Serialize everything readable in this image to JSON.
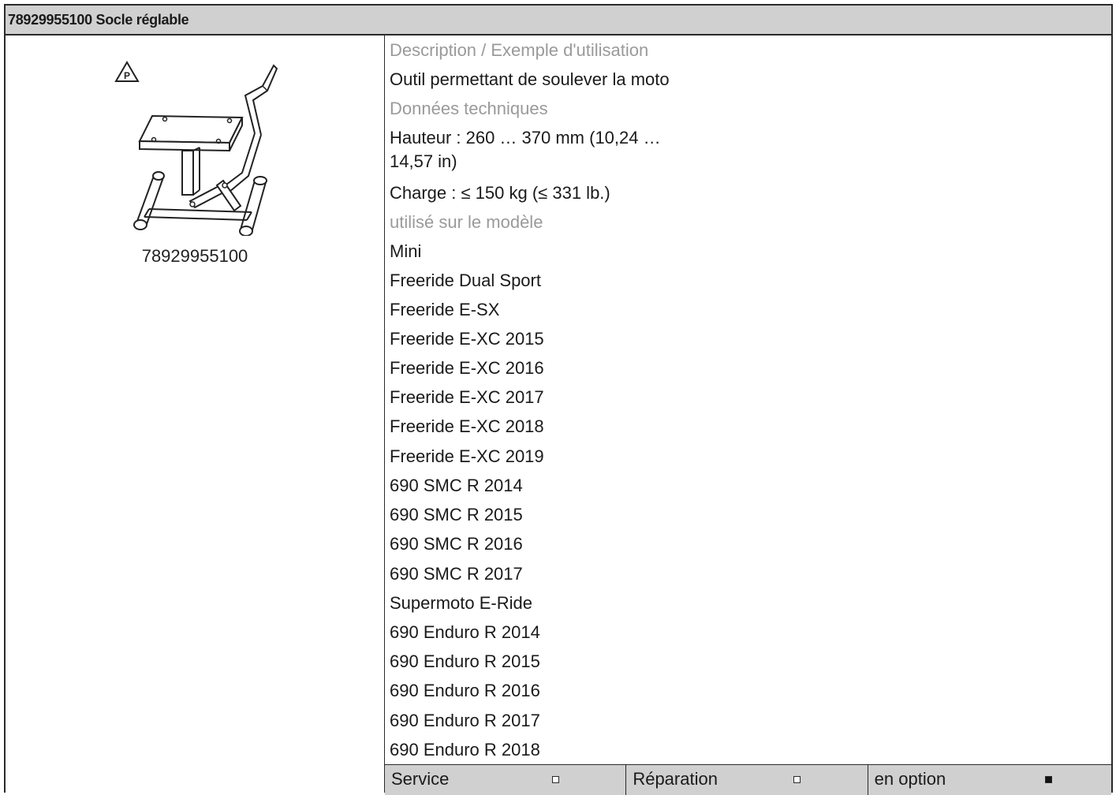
{
  "header": {
    "title": "78929955100 Socle réglable"
  },
  "figure": {
    "caption": "78929955100",
    "symbol_letter": "P",
    "icon": "lift-stand-icon"
  },
  "details": {
    "description_heading": "Description / Exemple d'utilisation",
    "description": "Outil permettant de soulever la moto",
    "technical_heading": "Données techniques",
    "height_line1": "Hauteur : 260 … 370 mm (10,24 …",
    "height_line2": "14,57 in)",
    "load": "Charge : ≤ 150 kg (≤ 331 lb.)",
    "models_heading": "utilisé sur le modèle",
    "models": [
      "Mini",
      "Freeride Dual Sport",
      "Freeride E-SX",
      "Freeride E-XC 2015",
      "Freeride E-XC 2016",
      "Freeride E-XC 2017",
      "Freeride E-XC 2018",
      "Freeride E-XC 2019",
      "690 SMC R 2014",
      "690 SMC R 2015",
      "690 SMC R 2016",
      "690 SMC R 2017",
      "Supermoto E-Ride",
      "690 Enduro R 2014",
      "690 Enduro R 2015",
      "690 Enduro R 2016",
      "690 Enduro R 2017",
      "690 Enduro R 2018"
    ]
  },
  "footer": {
    "service_label": "Service",
    "service_checked": false,
    "repair_label": "Réparation",
    "repair_checked": false,
    "optional_label": "en option",
    "optional_checked": true
  }
}
